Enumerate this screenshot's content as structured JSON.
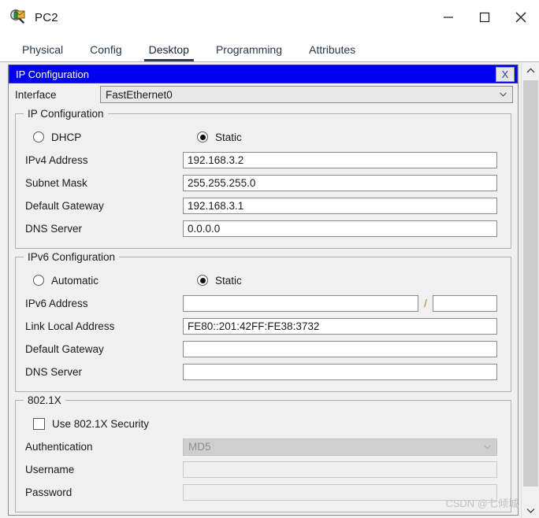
{
  "window": {
    "title": "PC2",
    "icon": "packet-tracer-pc-icon",
    "minimize": "─",
    "maximize": "□",
    "close": "✕"
  },
  "tabs": [
    {
      "label": "Physical",
      "active": false
    },
    {
      "label": "Config",
      "active": false
    },
    {
      "label": "Desktop",
      "active": true
    },
    {
      "label": "Programming",
      "active": false
    },
    {
      "label": "Attributes",
      "active": false
    }
  ],
  "dialog": {
    "caption": "IP Configuration",
    "close_label": "X"
  },
  "interface": {
    "label": "Interface",
    "value": "FastEthernet0"
  },
  "ipv4": {
    "group_title": "IP Configuration",
    "mode_dhcp": "DHCP",
    "mode_static": "Static",
    "selected_mode": "Static",
    "fields": [
      {
        "label": "IPv4 Address",
        "value": "192.168.3.2",
        "disabled": false
      },
      {
        "label": "Subnet Mask",
        "value": "255.255.255.0",
        "disabled": false
      },
      {
        "label": "Default Gateway",
        "value": "192.168.3.1",
        "disabled": false
      },
      {
        "label": "DNS Server",
        "value": "0.0.0.0",
        "disabled": false
      }
    ]
  },
  "ipv6": {
    "group_title": "IPv6 Configuration",
    "mode_automatic": "Automatic",
    "mode_static": "Static",
    "selected_mode": "Static",
    "address_label": "IPv6 Address",
    "address_value": "",
    "slash": "/",
    "prefix_value": "",
    "fields": [
      {
        "label": "Link Local Address",
        "value": "FE80::201:42FF:FE38:3732",
        "disabled": false
      },
      {
        "label": "Default Gateway",
        "value": "",
        "disabled": false
      },
      {
        "label": "DNS Server",
        "value": "",
        "disabled": false
      }
    ]
  },
  "dot1x": {
    "group_title": "802.1X",
    "use_security_label": "Use 802.1X Security",
    "use_security_checked": false,
    "authentication_label": "Authentication",
    "authentication_value": "MD5",
    "username_label": "Username",
    "username_value": "",
    "password_label": "Password",
    "password_value": ""
  },
  "watermark": "CSDN @七倾城",
  "colors": {
    "caption_blue": "#0000f0",
    "tab_active_underline": "#2d3e56",
    "panel_bg": "#f0f0f0",
    "field_bg": "#ffffff"
  }
}
